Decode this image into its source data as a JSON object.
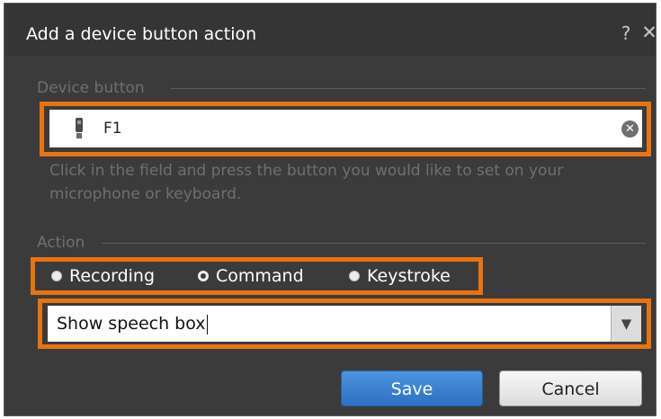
{
  "dialog": {
    "title": "Add a device button action",
    "help_label": "?",
    "close_label": "✕"
  },
  "device_button_group": {
    "label": "Device button",
    "field_value": "F1",
    "field_icon": "microphone-icon",
    "clear_icon": "clear-icon",
    "clear_label": "✕",
    "hint": "Click in the field and press the button you would like to set on your microphone or keyboard."
  },
  "action_group": {
    "label": "Action",
    "options": [
      {
        "label": "Recording",
        "selected": false
      },
      {
        "label": "Command",
        "selected": true
      },
      {
        "label": "Keystroke",
        "selected": false
      }
    ],
    "command_value": "Show speech box",
    "dropdown_icon": "▼"
  },
  "buttons": {
    "save_label": "Save",
    "cancel_label": "Cancel"
  },
  "colors": {
    "highlight": "#e8730f",
    "dialog_background": "#3b3b3b",
    "save_button": "#2d71c3"
  }
}
